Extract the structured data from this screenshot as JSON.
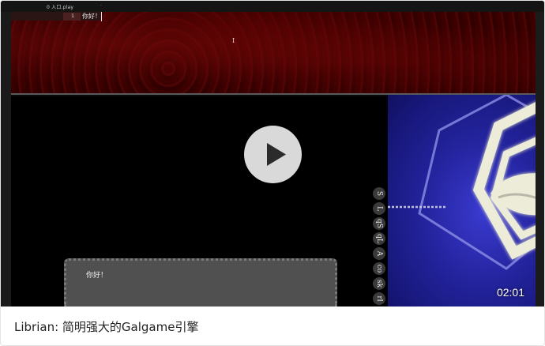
{
  "editor": {
    "tab_label": "0 入口.play",
    "tab_close": "·",
    "line_number": "1",
    "code_line": "你好！",
    "cursor_glyph": "I"
  },
  "game": {
    "dialogue_text": "你好！",
    "side_buttons": [
      "S",
      "L",
      "qS",
      "qL",
      "A",
      "co",
      "sk",
      "rl"
    ]
  },
  "video": {
    "duration": "02:01",
    "play_icon": "play-icon"
  },
  "caption": {
    "title": "Librian: 简明强大的Galgame引擎"
  },
  "colors": {
    "editor_bg": "#3d0202",
    "art_bg": "#23239c",
    "caption_text": "#222222"
  }
}
